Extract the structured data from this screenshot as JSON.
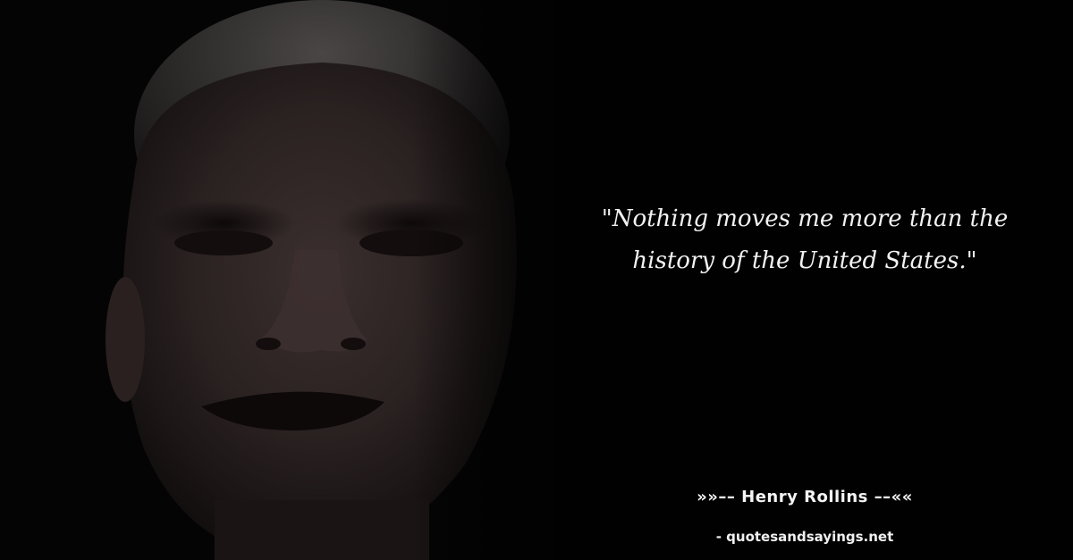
{
  "quote": {
    "line1": "\"Nothing moves me more than the",
    "line2": "history of the United States.\""
  },
  "author": "»»–– Henry Rollins ––««",
  "source": "- quotesandsayings.net"
}
